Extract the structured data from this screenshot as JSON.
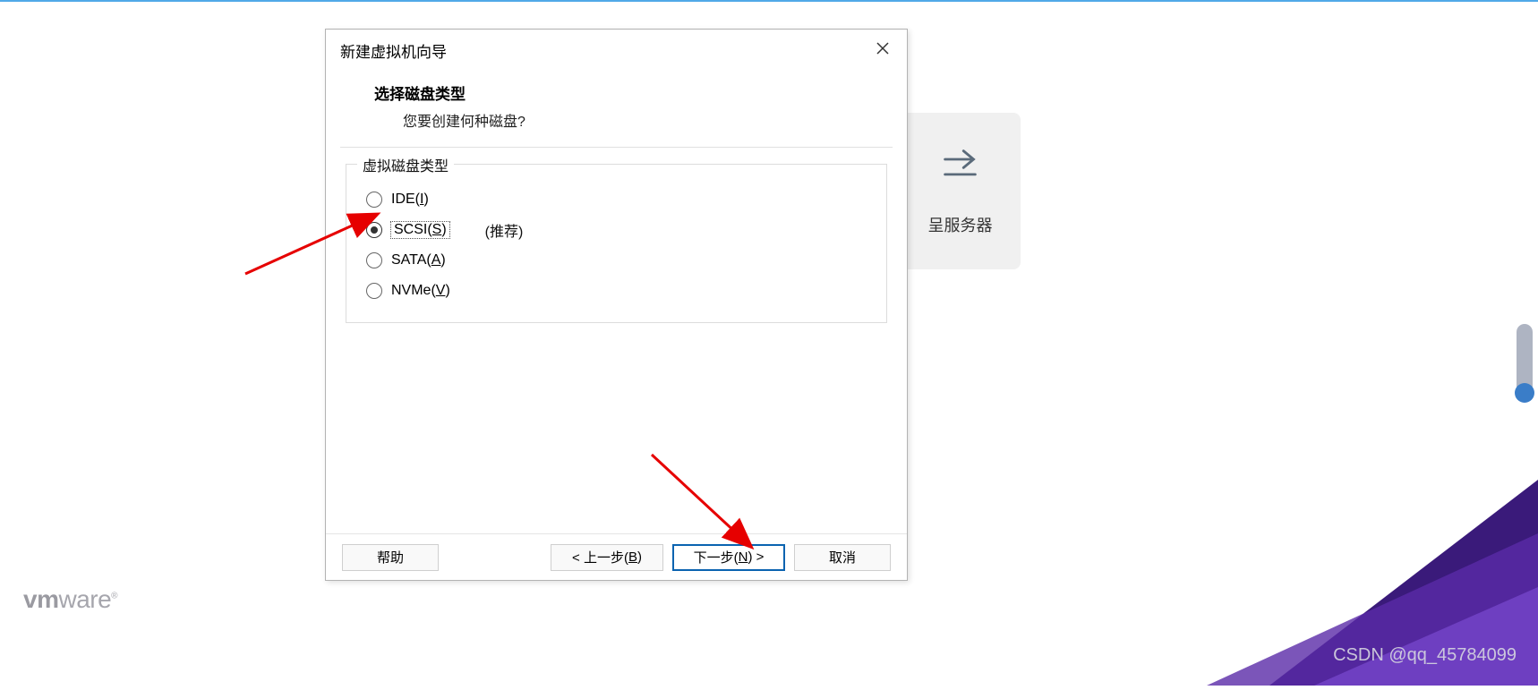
{
  "dialog": {
    "title": "新建虚拟机向导",
    "heading": "选择磁盘类型",
    "subtext": "您要创建何种磁盘?"
  },
  "groupbox": {
    "legend": "虚拟磁盘类型",
    "options": [
      {
        "label_prefix": "IDE(",
        "mnemonic": "I",
        "label_suffix": ")",
        "checked": false,
        "hint": ""
      },
      {
        "label_prefix": "SCSI(",
        "mnemonic": "S",
        "label_suffix": ")",
        "checked": true,
        "hint": "(推荐)"
      },
      {
        "label_prefix": "SATA(",
        "mnemonic": "A",
        "label_suffix": ")",
        "checked": false,
        "hint": ""
      },
      {
        "label_prefix": "NVMe(",
        "mnemonic": "V",
        "label_suffix": ")",
        "checked": false,
        "hint": ""
      }
    ]
  },
  "buttons": {
    "help": "帮助",
    "back": {
      "prefix": "< 上一步(",
      "mnemonic": "B",
      "suffix": ")"
    },
    "next": {
      "prefix": "下一步(",
      "mnemonic": "N",
      "suffix": ") >"
    },
    "cancel": "取消"
  },
  "bg_card": {
    "label": "呈服务器"
  },
  "logo_text": "vmware",
  "watermark": "CSDN @qq_45784099"
}
